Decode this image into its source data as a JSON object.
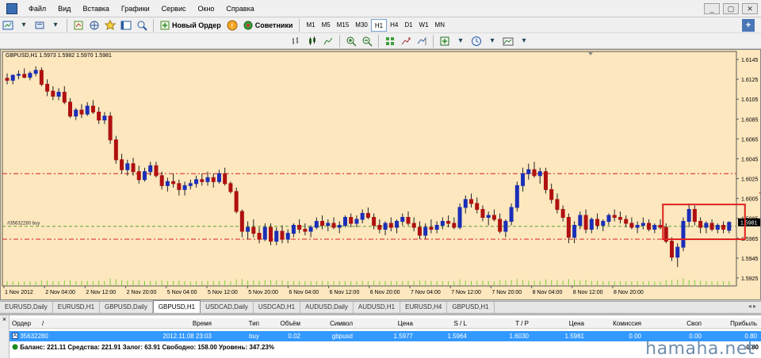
{
  "menu": {
    "items": [
      "Файл",
      "Вид",
      "Вставка",
      "Графики",
      "Сервис",
      "Окно",
      "Справка"
    ],
    "window_controls": [
      "_",
      "▢",
      "✕"
    ]
  },
  "toolbar": {
    "new_order_label": "Новый Ордер",
    "advisors_label": "Советники",
    "timeframes": [
      "M1",
      "M5",
      "M15",
      "M30",
      "H1",
      "H4",
      "D1",
      "W1",
      "MN"
    ],
    "active_timeframe": "H1"
  },
  "chart": {
    "header": "GBPUSD,H1  1.5973 1.5982 1.5970 1.5981",
    "order_label": "#35632280 buy",
    "current_price_label": "1.5981",
    "price_ticks": [
      "1.6145",
      "1.6125",
      "1.6105",
      "1.6085",
      "1.6065",
      "1.6045",
      "1.6025",
      "1.6005",
      "1.5985",
      "1.5965",
      "1.5945",
      "1.5925"
    ],
    "time_ticks": [
      "1 Nov 2012",
      "2 Nov 04:00",
      "2 Nov 12:00",
      "2 Nov 20:00",
      "5 Nov 04:00",
      "5 Nov 12:00",
      "5 Nov 20:00",
      "6 Nov 04:00",
      "6 Nov 12:00",
      "6 Nov 20:00",
      "7 Nov 04:00",
      "7 Nov 12:00",
      "7 Nov 20:00",
      "8 Nov 04:00",
      "8 Nov 12:00",
      "8 Nov 20:00"
    ],
    "colors": {
      "background": "#fce7be",
      "bull": "#1a2eb8",
      "bear": "#b01010",
      "volume": "#7ccf3c",
      "level_red": "#d62020",
      "level_green": "#60a030",
      "box": "#e02020"
    }
  },
  "chart_data": {
    "type": "candlestick",
    "symbol": "GBPUSD",
    "timeframe": "H1",
    "last_ohlc": {
      "open": 1.5973,
      "high": 1.5982,
      "low": 1.597,
      "close": 1.5981
    },
    "ylim": [
      1.5917,
      1.6153
    ],
    "levels": {
      "take_profit": 1.603,
      "open_price": 1.5977,
      "stop_loss": 1.5964
    },
    "candles": [
      [
        1.6126,
        1.6131,
        1.612,
        1.6124
      ],
      [
        1.6124,
        1.613,
        1.612,
        1.6129
      ],
      [
        1.6129,
        1.6134,
        1.6125,
        1.613
      ],
      [
        1.613,
        1.6136,
        1.6126,
        1.6127
      ],
      [
        1.6127,
        1.6133,
        1.6124,
        1.6131
      ],
      [
        1.6131,
        1.6138,
        1.6128,
        1.6134
      ],
      [
        1.6134,
        1.6137,
        1.6118,
        1.612
      ],
      [
        1.612,
        1.6125,
        1.6108,
        1.6113
      ],
      [
        1.6113,
        1.6118,
        1.6104,
        1.6108
      ],
      [
        1.6108,
        1.6116,
        1.6104,
        1.6112
      ],
      [
        1.6112,
        1.6118,
        1.61,
        1.6102
      ],
      [
        1.6102,
        1.6106,
        1.6086,
        1.6088
      ],
      [
        1.6088,
        1.6096,
        1.6084,
        1.6094
      ],
      [
        1.6094,
        1.61,
        1.6086,
        1.609
      ],
      [
        1.609,
        1.6102,
        1.6088,
        1.6098
      ],
      [
        1.6098,
        1.6104,
        1.609,
        1.6092
      ],
      [
        1.6092,
        1.6097,
        1.608,
        1.6084
      ],
      [
        1.6084,
        1.6092,
        1.608,
        1.6088
      ],
      [
        1.6088,
        1.6092,
        1.606,
        1.6064
      ],
      [
        1.6064,
        1.6068,
        1.604,
        1.6044
      ],
      [
        1.6044,
        1.605,
        1.603,
        1.6034
      ],
      [
        1.6034,
        1.6044,
        1.6028,
        1.604
      ],
      [
        1.604,
        1.6046,
        1.6028,
        1.6032
      ],
      [
        1.6032,
        1.6038,
        1.602,
        1.6024
      ],
      [
        1.6024,
        1.6036,
        1.6022,
        1.6032
      ],
      [
        1.6032,
        1.6042,
        1.6028,
        1.6038
      ],
      [
        1.6038,
        1.6042,
        1.6026,
        1.6028
      ],
      [
        1.6028,
        1.6032,
        1.6014,
        1.6018
      ],
      [
        1.6018,
        1.6026,
        1.6012,
        1.6022
      ],
      [
        1.6022,
        1.603,
        1.6016,
        1.602
      ],
      [
        1.602,
        1.6024,
        1.6008,
        1.6014
      ],
      [
        1.6014,
        1.6022,
        1.6008,
        1.6018
      ],
      [
        1.6018,
        1.6024,
        1.6014,
        1.602
      ],
      [
        1.602,
        1.6028,
        1.6016,
        1.6024
      ],
      [
        1.6024,
        1.603,
        1.6018,
        1.6022
      ],
      [
        1.6022,
        1.6032,
        1.6018,
        1.6026
      ],
      [
        1.6026,
        1.603,
        1.6016,
        1.6022
      ],
      [
        1.6022,
        1.6034,
        1.602,
        1.603
      ],
      [
        1.603,
        1.6036,
        1.6018,
        1.602
      ],
      [
        1.602,
        1.6022,
        1.601,
        1.6012
      ],
      [
        1.6012,
        1.6016,
        1.599,
        1.5992
      ],
      [
        1.5992,
        1.5994,
        1.5966,
        1.5972
      ],
      [
        1.5972,
        1.5982,
        1.5964,
        1.5976
      ],
      [
        1.5976,
        1.5984,
        1.5966,
        1.597
      ],
      [
        1.597,
        1.5976,
        1.596,
        1.5964
      ],
      [
        1.5964,
        1.598,
        1.5962,
        1.5976
      ],
      [
        1.5976,
        1.598,
        1.5958,
        1.5962
      ],
      [
        1.5962,
        1.5976,
        1.5958,
        1.5972
      ],
      [
        1.5972,
        1.5978,
        1.596,
        1.5964
      ],
      [
        1.5964,
        1.5974,
        1.596,
        1.597
      ],
      [
        1.597,
        1.598,
        1.5966,
        1.5978
      ],
      [
        1.5978,
        1.5984,
        1.597,
        1.5974
      ],
      [
        1.5974,
        1.598,
        1.5968,
        1.5972
      ],
      [
        1.5972,
        1.5978,
        1.5966,
        1.5976
      ],
      [
        1.5976,
        1.5986,
        1.5974,
        1.5982
      ],
      [
        1.5982,
        1.5988,
        1.5974,
        1.5978
      ],
      [
        1.5978,
        1.5984,
        1.5972,
        1.598
      ],
      [
        1.598,
        1.5986,
        1.5974,
        1.5976
      ],
      [
        1.5976,
        1.5982,
        1.597,
        1.5978
      ],
      [
        1.5978,
        1.5988,
        1.5976,
        1.5986
      ],
      [
        1.5986,
        1.599,
        1.5976,
        1.598
      ],
      [
        1.598,
        1.5988,
        1.5976,
        1.5984
      ],
      [
        1.5984,
        1.5994,
        1.598,
        1.599
      ],
      [
        1.599,
        1.5996,
        1.5984,
        1.5986
      ],
      [
        1.5986,
        1.599,
        1.5974,
        1.5978
      ],
      [
        1.5978,
        1.5984,
        1.597,
        1.5974
      ],
      [
        1.5974,
        1.5982,
        1.5968,
        1.598
      ],
      [
        1.598,
        1.5986,
        1.5972,
        1.5976
      ],
      [
        1.5976,
        1.5984,
        1.597,
        1.5982
      ],
      [
        1.5982,
        1.599,
        1.5978,
        1.5986
      ],
      [
        1.5986,
        1.5992,
        1.5978,
        1.598
      ],
      [
        1.598,
        1.5986,
        1.5972,
        1.5976
      ],
      [
        1.5976,
        1.5982,
        1.5964,
        1.5968
      ],
      [
        1.5968,
        1.598,
        1.5964,
        1.5976
      ],
      [
        1.5976,
        1.5984,
        1.597,
        1.5974
      ],
      [
        1.5974,
        1.5982,
        1.597,
        1.5978
      ],
      [
        1.5978,
        1.5986,
        1.5974,
        1.5982
      ],
      [
        1.5982,
        1.5988,
        1.5976,
        1.598
      ],
      [
        1.598,
        1.5986,
        1.5974,
        1.5976
      ],
      [
        1.5976,
        1.6,
        1.5974,
        1.5996
      ],
      [
        1.5996,
        1.6008,
        1.599,
        1.6004
      ],
      [
        1.6004,
        1.601,
        1.5996,
        1.6
      ],
      [
        1.6,
        1.6006,
        1.599,
        1.5994
      ],
      [
        1.5994,
        1.5998,
        1.5982,
        1.5986
      ],
      [
        1.5986,
        1.5992,
        1.5978,
        1.5988
      ],
      [
        1.5988,
        1.5994,
        1.5982,
        1.5984
      ],
      [
        1.5984,
        1.599,
        1.597,
        1.5972
      ],
      [
        1.5972,
        1.5984,
        1.5966,
        1.5982
      ],
      [
        1.5982,
        1.6,
        1.5978,
        1.5996
      ],
      [
        1.5996,
        1.6022,
        1.5992,
        1.6018
      ],
      [
        1.6018,
        1.6036,
        1.6012,
        1.603
      ],
      [
        1.603,
        1.604,
        1.6024,
        1.6034
      ],
      [
        1.6034,
        1.6042,
        1.6026,
        1.6028
      ],
      [
        1.6028,
        1.6036,
        1.602,
        1.6032
      ],
      [
        1.6032,
        1.6036,
        1.601,
        1.6014
      ],
      [
        1.6014,
        1.602,
        1.6,
        1.6004
      ],
      [
        1.6004,
        1.601,
        1.599,
        1.5994
      ],
      [
        1.5994,
        1.5998,
        1.5982,
        1.5986
      ],
      [
        1.5986,
        1.599,
        1.596,
        1.5966
      ],
      [
        1.5966,
        1.5982,
        1.596,
        1.5978
      ],
      [
        1.5978,
        1.5992,
        1.5974,
        1.5988
      ],
      [
        1.5988,
        1.5994,
        1.597,
        1.5974
      ],
      [
        1.5974,
        1.5986,
        1.597,
        1.5984
      ],
      [
        1.5984,
        1.599,
        1.5974,
        1.5978
      ],
      [
        1.5978,
        1.5984,
        1.5972,
        1.5982
      ],
      [
        1.5982,
        1.599,
        1.5978,
        1.5988
      ],
      [
        1.5988,
        1.5994,
        1.5982,
        1.5986
      ],
      [
        1.5986,
        1.5992,
        1.598,
        1.5984
      ],
      [
        1.5984,
        1.5988,
        1.5976,
        1.598
      ],
      [
        1.598,
        1.5986,
        1.5974,
        1.5976
      ],
      [
        1.5976,
        1.5982,
        1.597,
        1.5978
      ],
      [
        1.5978,
        1.5986,
        1.5974,
        1.598
      ],
      [
        1.598,
        1.5984,
        1.5972,
        1.5974
      ],
      [
        1.5974,
        1.598,
        1.597,
        1.5978
      ],
      [
        1.5978,
        1.5984,
        1.5974,
        1.5976
      ],
      [
        1.5976,
        1.598,
        1.596,
        1.5962
      ],
      [
        1.5962,
        1.5966,
        1.5942,
        1.5946
      ],
      [
        1.5946,
        1.596,
        1.5936,
        1.5956
      ],
      [
        1.5956,
        1.5986,
        1.5952,
        1.5982
      ],
      [
        1.5982,
        1.6,
        1.5976,
        1.5994
      ],
      [
        1.5994,
        1.5998,
        1.5978,
        1.5982
      ],
      [
        1.5982,
        1.5986,
        1.597,
        1.5976
      ],
      [
        1.5976,
        1.5982,
        1.597,
        1.598
      ],
      [
        1.598,
        1.5984,
        1.5972,
        1.5974
      ],
      [
        1.5974,
        1.598,
        1.597,
        1.5978
      ],
      [
        1.5978,
        1.5982,
        1.597,
        1.5974
      ],
      [
        1.5973,
        1.5982,
        1.597,
        1.5981
      ]
    ]
  },
  "tabs": {
    "items": [
      "EURUSD,Daily",
      "EURUSD,H1",
      "GBPUSD,Daily",
      "GBPUSD,H1",
      "USDCAD,Daily",
      "USDCAD,H1",
      "AUDUSD,Daily",
      "AUDUSD,H1",
      "EURUSD,H4",
      "GBPUSD,H1"
    ],
    "active_index": 3
  },
  "terminal": {
    "headers": {
      "order": "Ордер",
      "sort": "/",
      "time": "Время",
      "type": "Тип",
      "volume": "Объём",
      "symbol": "Символ",
      "price": "Цена",
      "sl": "S / L",
      "tp": "T / P",
      "price2": "Цена",
      "commission": "Комиссия",
      "swap": "Своп",
      "profit": "Прибыль"
    },
    "row": {
      "order": "35632280",
      "time": "2012.11.08 23:03",
      "type": "buy",
      "volume": "0.02",
      "symbol": "gbpusd",
      "price": "1.5977",
      "sl": "1.5964",
      "tp": "1.6030",
      "price2": "1.5981",
      "commission": "0.00",
      "swap": "0.00",
      "profit": "0.80"
    },
    "balance_line": "Баланс: 221.11  Средства: 221.91  Залог: 63.91  Свободно: 158.00  Уровень: 347.23%",
    "balance_profit": "0.80"
  },
  "watermark": "hamaha.net"
}
